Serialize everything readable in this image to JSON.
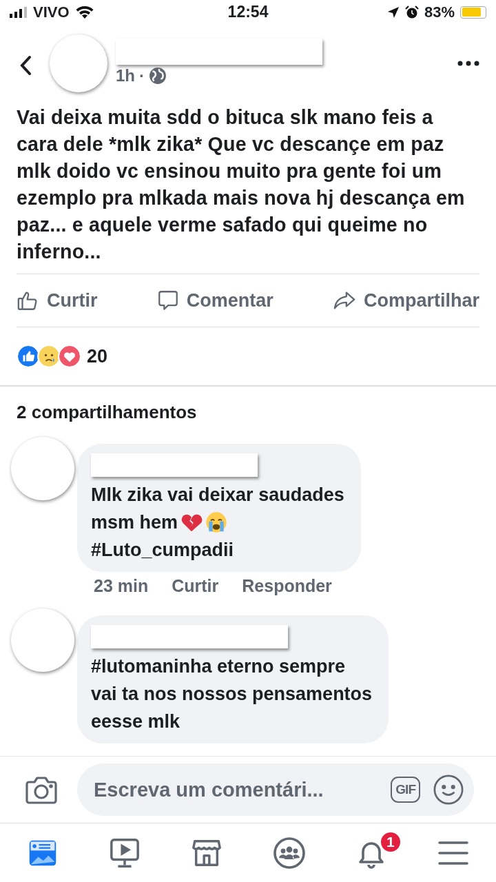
{
  "status_bar": {
    "carrier": "VIVO",
    "time": "12:54",
    "battery_percent": "83%",
    "battery": {
      "level": 0.83
    }
  },
  "post": {
    "time": "1h",
    "separator": "·",
    "text": "Vai deixa muita sdd o bituca slk mano feis a cara dele *mlk zika* Que vc descançe em paz mlk doido vc ensinou muito pra gente foi um ezemplo pra mlkada mais nova hj descança em paz... e aquele verme safado qui queime no inferno...",
    "actions": [
      {
        "kind": "like",
        "label": "Curtir"
      },
      {
        "kind": "comment",
        "label": "Comentar"
      },
      {
        "kind": "share",
        "label": "Compartilhar"
      }
    ],
    "reactions": [
      {
        "kind": "like"
      },
      {
        "kind": "sad"
      },
      {
        "kind": "love"
      }
    ],
    "reaction_count": "20"
  },
  "shares": "2 compartilhamentos",
  "comments": [
    {
      "lines": [
        "Mlk zika vai deixar saudades",
        "msm hem"
      ],
      "emoji": [
        {
          "kind": "broken_heart"
        },
        {
          "kind": "crying"
        }
      ],
      "hashtag": "#Luto_cumpadii",
      "time": "23 min",
      "actions": [
        "Curtir",
        "Responder"
      ]
    },
    {
      "lines": [
        "#lutomaninha eterno sempre",
        "vai ta nos nossos pensamentos",
        "eesse mlk"
      ]
    }
  ],
  "composer": {
    "placeholder": "Escreva um comentári...",
    "gif": "GIF"
  },
  "tabs": [
    {
      "kind": "feed",
      "selected": true
    },
    {
      "kind": "video",
      "selected": false
    },
    {
      "kind": "marketplace",
      "selected": false
    },
    {
      "kind": "groups",
      "selected": false
    },
    {
      "kind": "notifications",
      "selected": false,
      "badge": "1"
    },
    {
      "kind": "menu",
      "selected": false
    }
  ]
}
